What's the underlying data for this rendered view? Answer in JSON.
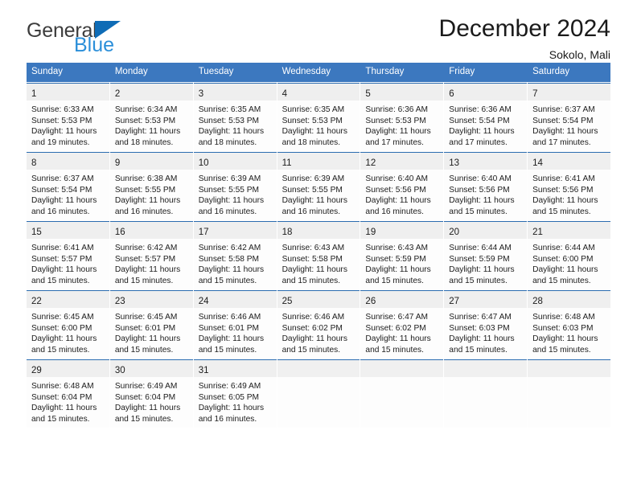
{
  "brand": {
    "name_top": "General",
    "name_bottom": "Blue",
    "triangle_color": "#0f6cb6",
    "bottom_color": "#2b8fd9"
  },
  "header": {
    "title": "December 2024",
    "subtitle": "Sokolo, Mali"
  },
  "theme": {
    "header_blue": "#3c78bf",
    "row_rule_blue": "#2b6cb0",
    "daynum_band": "#efefef"
  },
  "weekdays": [
    "Sunday",
    "Monday",
    "Tuesday",
    "Wednesday",
    "Thursday",
    "Friday",
    "Saturday"
  ],
  "weeks": [
    [
      {
        "day": "1",
        "sunrise": "Sunrise: 6:33 AM",
        "sunset": "Sunset: 5:53 PM",
        "daylight1": "Daylight: 11 hours",
        "daylight2": "and 19 minutes."
      },
      {
        "day": "2",
        "sunrise": "Sunrise: 6:34 AM",
        "sunset": "Sunset: 5:53 PM",
        "daylight1": "Daylight: 11 hours",
        "daylight2": "and 18 minutes."
      },
      {
        "day": "3",
        "sunrise": "Sunrise: 6:35 AM",
        "sunset": "Sunset: 5:53 PM",
        "daylight1": "Daylight: 11 hours",
        "daylight2": "and 18 minutes."
      },
      {
        "day": "4",
        "sunrise": "Sunrise: 6:35 AM",
        "sunset": "Sunset: 5:53 PM",
        "daylight1": "Daylight: 11 hours",
        "daylight2": "and 18 minutes."
      },
      {
        "day": "5",
        "sunrise": "Sunrise: 6:36 AM",
        "sunset": "Sunset: 5:53 PM",
        "daylight1": "Daylight: 11 hours",
        "daylight2": "and 17 minutes."
      },
      {
        "day": "6",
        "sunrise": "Sunrise: 6:36 AM",
        "sunset": "Sunset: 5:54 PM",
        "daylight1": "Daylight: 11 hours",
        "daylight2": "and 17 minutes."
      },
      {
        "day": "7",
        "sunrise": "Sunrise: 6:37 AM",
        "sunset": "Sunset: 5:54 PM",
        "daylight1": "Daylight: 11 hours",
        "daylight2": "and 17 minutes."
      }
    ],
    [
      {
        "day": "8",
        "sunrise": "Sunrise: 6:37 AM",
        "sunset": "Sunset: 5:54 PM",
        "daylight1": "Daylight: 11 hours",
        "daylight2": "and 16 minutes."
      },
      {
        "day": "9",
        "sunrise": "Sunrise: 6:38 AM",
        "sunset": "Sunset: 5:55 PM",
        "daylight1": "Daylight: 11 hours",
        "daylight2": "and 16 minutes."
      },
      {
        "day": "10",
        "sunrise": "Sunrise: 6:39 AM",
        "sunset": "Sunset: 5:55 PM",
        "daylight1": "Daylight: 11 hours",
        "daylight2": "and 16 minutes."
      },
      {
        "day": "11",
        "sunrise": "Sunrise: 6:39 AM",
        "sunset": "Sunset: 5:55 PM",
        "daylight1": "Daylight: 11 hours",
        "daylight2": "and 16 minutes."
      },
      {
        "day": "12",
        "sunrise": "Sunrise: 6:40 AM",
        "sunset": "Sunset: 5:56 PM",
        "daylight1": "Daylight: 11 hours",
        "daylight2": "and 16 minutes."
      },
      {
        "day": "13",
        "sunrise": "Sunrise: 6:40 AM",
        "sunset": "Sunset: 5:56 PM",
        "daylight1": "Daylight: 11 hours",
        "daylight2": "and 15 minutes."
      },
      {
        "day": "14",
        "sunrise": "Sunrise: 6:41 AM",
        "sunset": "Sunset: 5:56 PM",
        "daylight1": "Daylight: 11 hours",
        "daylight2": "and 15 minutes."
      }
    ],
    [
      {
        "day": "15",
        "sunrise": "Sunrise: 6:41 AM",
        "sunset": "Sunset: 5:57 PM",
        "daylight1": "Daylight: 11 hours",
        "daylight2": "and 15 minutes."
      },
      {
        "day": "16",
        "sunrise": "Sunrise: 6:42 AM",
        "sunset": "Sunset: 5:57 PM",
        "daylight1": "Daylight: 11 hours",
        "daylight2": "and 15 minutes."
      },
      {
        "day": "17",
        "sunrise": "Sunrise: 6:42 AM",
        "sunset": "Sunset: 5:58 PM",
        "daylight1": "Daylight: 11 hours",
        "daylight2": "and 15 minutes."
      },
      {
        "day": "18",
        "sunrise": "Sunrise: 6:43 AM",
        "sunset": "Sunset: 5:58 PM",
        "daylight1": "Daylight: 11 hours",
        "daylight2": "and 15 minutes."
      },
      {
        "day": "19",
        "sunrise": "Sunrise: 6:43 AM",
        "sunset": "Sunset: 5:59 PM",
        "daylight1": "Daylight: 11 hours",
        "daylight2": "and 15 minutes."
      },
      {
        "day": "20",
        "sunrise": "Sunrise: 6:44 AM",
        "sunset": "Sunset: 5:59 PM",
        "daylight1": "Daylight: 11 hours",
        "daylight2": "and 15 minutes."
      },
      {
        "day": "21",
        "sunrise": "Sunrise: 6:44 AM",
        "sunset": "Sunset: 6:00 PM",
        "daylight1": "Daylight: 11 hours",
        "daylight2": "and 15 minutes."
      }
    ],
    [
      {
        "day": "22",
        "sunrise": "Sunrise: 6:45 AM",
        "sunset": "Sunset: 6:00 PM",
        "daylight1": "Daylight: 11 hours",
        "daylight2": "and 15 minutes."
      },
      {
        "day": "23",
        "sunrise": "Sunrise: 6:45 AM",
        "sunset": "Sunset: 6:01 PM",
        "daylight1": "Daylight: 11 hours",
        "daylight2": "and 15 minutes."
      },
      {
        "day": "24",
        "sunrise": "Sunrise: 6:46 AM",
        "sunset": "Sunset: 6:01 PM",
        "daylight1": "Daylight: 11 hours",
        "daylight2": "and 15 minutes."
      },
      {
        "day": "25",
        "sunrise": "Sunrise: 6:46 AM",
        "sunset": "Sunset: 6:02 PM",
        "daylight1": "Daylight: 11 hours",
        "daylight2": "and 15 minutes."
      },
      {
        "day": "26",
        "sunrise": "Sunrise: 6:47 AM",
        "sunset": "Sunset: 6:02 PM",
        "daylight1": "Daylight: 11 hours",
        "daylight2": "and 15 minutes."
      },
      {
        "day": "27",
        "sunrise": "Sunrise: 6:47 AM",
        "sunset": "Sunset: 6:03 PM",
        "daylight1": "Daylight: 11 hours",
        "daylight2": "and 15 minutes."
      },
      {
        "day": "28",
        "sunrise": "Sunrise: 6:48 AM",
        "sunset": "Sunset: 6:03 PM",
        "daylight1": "Daylight: 11 hours",
        "daylight2": "and 15 minutes."
      }
    ],
    [
      {
        "day": "29",
        "sunrise": "Sunrise: 6:48 AM",
        "sunset": "Sunset: 6:04 PM",
        "daylight1": "Daylight: 11 hours",
        "daylight2": "and 15 minutes."
      },
      {
        "day": "30",
        "sunrise": "Sunrise: 6:49 AM",
        "sunset": "Sunset: 6:04 PM",
        "daylight1": "Daylight: 11 hours",
        "daylight2": "and 15 minutes."
      },
      {
        "day": "31",
        "sunrise": "Sunrise: 6:49 AM",
        "sunset": "Sunset: 6:05 PM",
        "daylight1": "Daylight: 11 hours",
        "daylight2": "and 16 minutes."
      },
      {
        "day": "",
        "sunrise": "",
        "sunset": "",
        "daylight1": "",
        "daylight2": ""
      },
      {
        "day": "",
        "sunrise": "",
        "sunset": "",
        "daylight1": "",
        "daylight2": ""
      },
      {
        "day": "",
        "sunrise": "",
        "sunset": "",
        "daylight1": "",
        "daylight2": ""
      },
      {
        "day": "",
        "sunrise": "",
        "sunset": "",
        "daylight1": "",
        "daylight2": ""
      }
    ]
  ]
}
